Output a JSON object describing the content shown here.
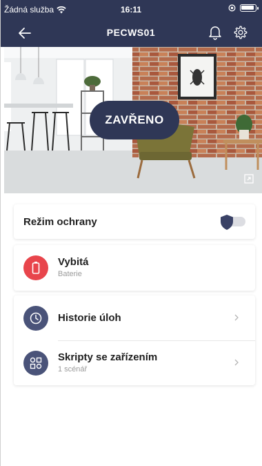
{
  "status_bar": {
    "carrier": "Žádná služba",
    "time": "16:11"
  },
  "nav": {
    "title": "PECWS01"
  },
  "hero": {
    "state_label": "ZAVŘENO"
  },
  "guard_mode": {
    "label": "Režim ochrany",
    "enabled": false
  },
  "battery": {
    "title": "Vybitá",
    "subtitle": "Baterie"
  },
  "history": {
    "title": "Historie úloh"
  },
  "scripts": {
    "title": "Skripty se zařízením",
    "subtitle": "1 scénář"
  },
  "colors": {
    "header_bg": "#2f3756",
    "battery_alert": "#e8454c",
    "icon_navy": "#4a5379"
  },
  "icons": {
    "wifi": "wifi-icon",
    "battery": "battery-icon",
    "back": "arrow-left-icon",
    "bell": "bell-icon",
    "gear": "gear-icon",
    "expand": "expand-icon",
    "battery_low": "battery-low-icon",
    "history": "clock-history-icon",
    "scripts": "scripts-icon",
    "chevron": "chevron-right-icon"
  }
}
